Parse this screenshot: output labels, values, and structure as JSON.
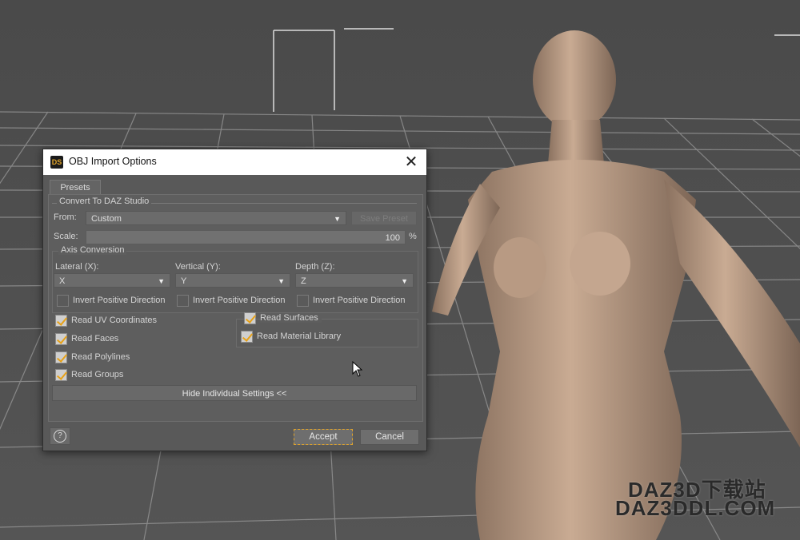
{
  "dialog": {
    "app_icon_text": "DS",
    "title": "OBJ Import Options",
    "close_symbol": "✕",
    "tab_presets": "Presets",
    "convert_group_label": "Convert To DAZ Studio",
    "from_label": "From:",
    "from_value": "Custom",
    "save_preset_label": "Save Preset",
    "scale_label": "Scale:",
    "scale_value": "100",
    "scale_unit": "%",
    "axis_group_label": "Axis Conversion",
    "lateral_label": "Lateral (X):",
    "lateral_value": "X",
    "vertical_label": "Vertical (Y):",
    "vertical_value": "Y",
    "depth_label": "Depth (Z):",
    "depth_value": "Z",
    "invert_label": "Invert Positive Direction",
    "read_uv": "Read UV Coordinates",
    "read_faces": "Read Faces",
    "read_polylines": "Read Polylines",
    "read_groups": "Read Groups",
    "read_surfaces": "Read Surfaces",
    "read_material_library": "Read Material Library",
    "hide_settings": "Hide Individual Settings <<",
    "help_symbol": "?",
    "accept": "Accept",
    "cancel": "Cancel"
  },
  "checkboxes": {
    "invert_x": false,
    "invert_y": false,
    "invert_z": false,
    "read_uv": true,
    "read_faces": true,
    "read_polylines": true,
    "read_groups": true,
    "read_surfaces": true,
    "read_material_library": true
  },
  "watermark": {
    "line1": "DAZ3D下载站",
    "line2": "DAZ3DDL.COM"
  },
  "colors": {
    "accent": "#e7a117",
    "dialog_bg": "#595959",
    "viewport_bg": "#4b4b4b"
  }
}
